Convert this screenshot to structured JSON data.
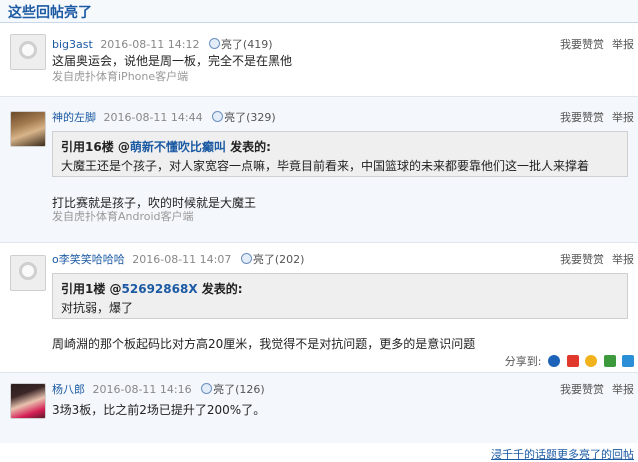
{
  "section_title": "这些回帖亮了",
  "actions": {
    "report_label": "我要赞赏",
    "flag_label": "举报"
  },
  "posts": [
    {
      "user": "big3ast",
      "time": "2016-08-11 14:12",
      "like": "亮了(419)",
      "text": "这届奥运会，说他是周一板，完全不是在黑他",
      "client": "发自虎扑体育iPhone客户端"
    },
    {
      "user": "神的左脚",
      "time": "2016-08-11 14:44",
      "like": "亮了(329)",
      "quote_prefix": "引用16楼 @",
      "quote_user": "萌新不懂吹比癫叫",
      "quote_suffix": " 发表的:",
      "quote_text": "大魔王还是个孩子，对人家宽容一点嘛，毕竟目前看来，中国篮球的未来都要靠他们这一批人来撑着",
      "text": "打比赛就是孩子，吹的时候就是大魔王",
      "client": "发自虎扑体育Android客户端"
    },
    {
      "user": "o李笑笑哈哈哈",
      "time": "2016-08-11 14:07",
      "like": "亮了(202)",
      "quote_prefix": "引用1楼 @",
      "quote_user": "52692868X",
      "quote_suffix": " 发表的:",
      "quote_text": "对抗弱，爆了",
      "text": "周崎淵的那个板起码比对方高20厘米，我觉得不是对抗问题，更多的是意识问题",
      "share_label": "分享到:"
    },
    {
      "user": "杨八郎",
      "time": "2016-08-11 14:16",
      "like": "亮了(126)",
      "text": "3场3板，比之前2场已提升了200%了。"
    }
  ],
  "bottom_link": "浸千千的话题更多亮了的回帖",
  "icons": {
    "avatar_default": "default-avatar-icon",
    "like": "light-bulb-icon",
    "share": [
      "renren-icon",
      "weibo-icon",
      "qzone-icon",
      "douban-icon",
      "tencent-icon"
    ]
  },
  "colors": {
    "link": "#1c5aa3",
    "quote_bg": "#efefef",
    "alt_row": "#f4f7fb"
  }
}
